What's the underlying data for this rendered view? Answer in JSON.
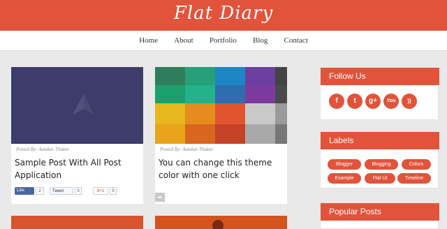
{
  "header": {
    "title": "Flat Diary"
  },
  "nav": {
    "items": [
      "Home",
      "About",
      "Portfolio",
      "Blog",
      "Contact"
    ]
  },
  "posts": [
    {
      "meta": "Posted By: Aumkar Thakur",
      "title": "Sample Post With All Post Application"
    },
    {
      "meta": "Posted By: Aumkar Thakur",
      "title": "You can change this theme color with one click"
    }
  ],
  "share": {
    "like_label": "Like",
    "like_count": "2",
    "tweet_label": "Tweet",
    "tweet_count": "0",
    "gplus_label": "8+1",
    "gplus_count": "0"
  },
  "sidebar": {
    "follow_title": "Follow Us",
    "social_icons": [
      {
        "icon": "facebook-icon",
        "glyph": "f"
      },
      {
        "icon": "twitter-icon",
        "glyph": "t"
      },
      {
        "icon": "googleplus-icon",
        "glyph": "g+"
      },
      {
        "icon": "youtube-icon",
        "glyph": "You"
      },
      {
        "icon": "rss-icon",
        "glyph": "))"
      }
    ],
    "labels_title": "Labels",
    "labels": [
      "Blogger",
      "Blogging",
      "Colors",
      "Example",
      "Flat UI",
      "Timeline"
    ],
    "popular_title": "Popular Posts"
  },
  "colors": {
    "accent": "#e1533a",
    "background": "#e9e9e9"
  }
}
